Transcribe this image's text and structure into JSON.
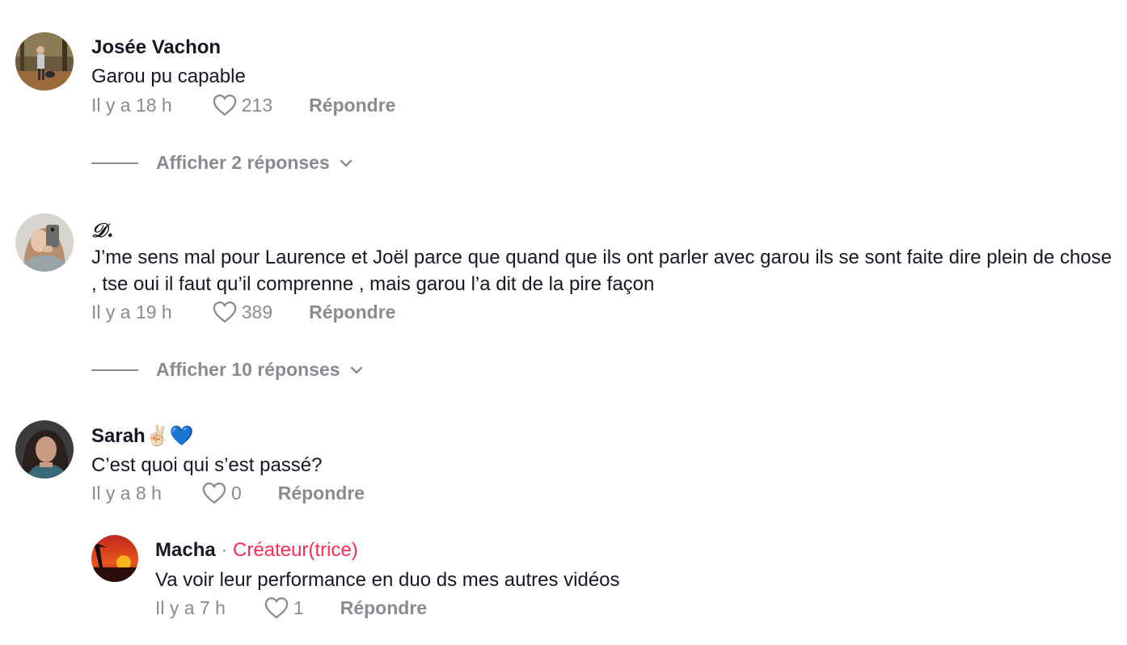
{
  "comments": [
    {
      "username": "Josée Vachon",
      "text": "Garou pu capable",
      "time": "Il y a 18 h",
      "likes": "213",
      "reply_label": "Répondre",
      "view_replies": "Afficher 2 réponses"
    },
    {
      "username": "𝒟.",
      "text": "J’me sens mal pour Laurence et Joël parce que quand que ils ont parler avec garou ils se sont faite dire plein de chose , tse oui il faut qu’il comprenne , mais garou l’a dit de la pire façon",
      "time": "Il y a 19 h",
      "likes": "389",
      "reply_label": "Répondre",
      "view_replies": "Afficher 10 réponses"
    },
    {
      "username": "Sarah",
      "username_emoji": "✌🏻💙",
      "text": "C’est quoi qui s’est passé?",
      "time": "Il y a 8 h",
      "likes": "0",
      "reply_label": "Répondre"
    }
  ],
  "reply": {
    "username": "Macha",
    "separator": "·",
    "creator_label": "Créateur(trice)",
    "text": "Va voir leur performance en duo ds mes autres vidéos",
    "time": "Il y a 7 h",
    "likes": "1",
    "reply_label": "Répondre"
  },
  "colors": {
    "text": "#161823",
    "muted": "#8a8b91",
    "creator": "#fe2c55"
  }
}
